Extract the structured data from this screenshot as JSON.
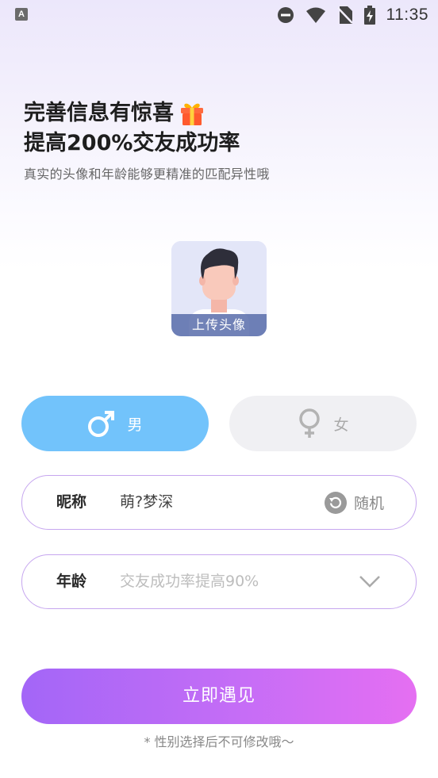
{
  "status_bar": {
    "app_icon_letter": "A",
    "time": "11:35"
  },
  "header": {
    "title_line1": "完善信息有惊喜",
    "title_line2": "提高200%交友成功率",
    "subtitle": "真实的头像和年龄能够更精准的匹配异性哦"
  },
  "avatar": {
    "upload_label": "上传头像"
  },
  "gender": {
    "male_label": "男",
    "female_label": "女",
    "selected": "male"
  },
  "nickname": {
    "label": "昵称",
    "value": "萌?梦深",
    "random_label": "随机"
  },
  "age": {
    "label": "年龄",
    "placeholder": "交友成功率提高90%"
  },
  "submit": {
    "label": "立即遇见"
  },
  "footnote": "* 性别选择后不可修改哦～",
  "colors": {
    "male_bg": "#72c3fb",
    "female_bg": "#f0f0f3",
    "field_border": "#c6a6ef",
    "submit_gradient_start": "#a366f7",
    "submit_gradient_end": "#e56ff2"
  }
}
